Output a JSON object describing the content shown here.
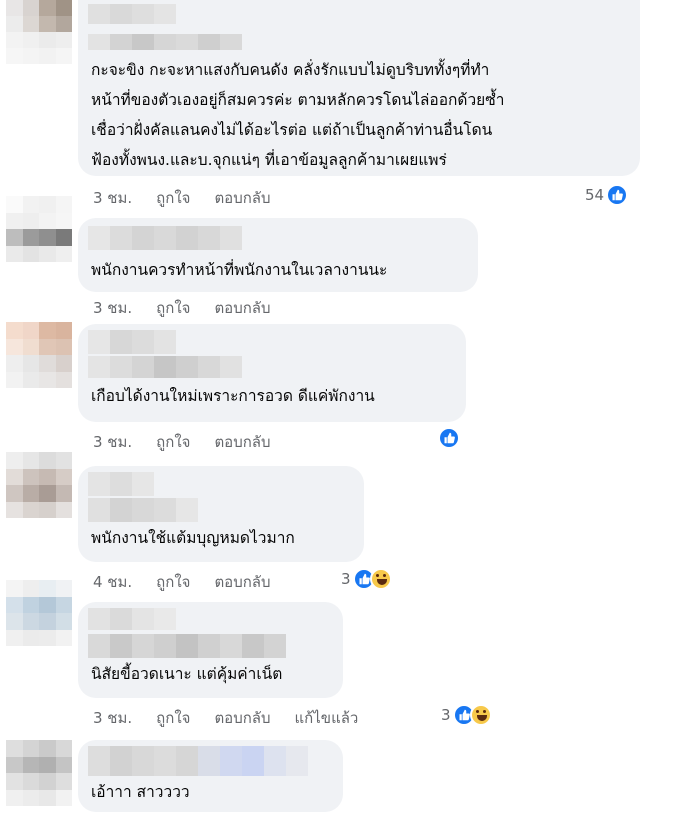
{
  "comments": [
    {
      "lines": [
        "กะจะขิง กะจะหาแสงกับคนดัง คลั่งรักแบบไม่ดูบริบททั้งๆที่ทำ",
        "หน้าที่ของตัวเองอยู่ก็สมควรค่ะ ตามหลักควรโดนไล่ออกด้วยซ้ำ",
        "เชื่อว่าฝั่งคัลแลนคงไม่ได้อะไรต่อ แต่ถ้าเป็นลูกค้าท่านอื่นโดน",
        "ฟ้องทั้งพนง.และบ.จุกแน่ๆ ที่เอาข้อมูลลูกค้ามาเผยแพร่"
      ],
      "time": "3 ชม.",
      "like_label": "ถูกใจ",
      "reply_label": "ตอบกลับ",
      "reaction_count": "54",
      "reactions": [
        "like-icon"
      ]
    },
    {
      "lines": [
        "พนักงานควรทำหน้าที่พนักงานในเวลางานนะ"
      ],
      "time": "3 ชม.",
      "like_label": "ถูกใจ",
      "reply_label": "ตอบกลับ",
      "reaction_count": "",
      "reactions": []
    },
    {
      "lines": [
        "เกือบได้งานใหม่เพราะการอวด ดีแค่พักงาน"
      ],
      "time": "3 ชม.",
      "like_label": "ถูกใจ",
      "reply_label": "ตอบกลับ",
      "reaction_count": "",
      "reactions": [
        "like-icon"
      ]
    },
    {
      "lines": [
        "พนักงานใช้แต้มบุญหมดไวมาก"
      ],
      "time": "4 ชม.",
      "like_label": "ถูกใจ",
      "reply_label": "ตอบกลับ",
      "reaction_count": "3",
      "reactions": [
        "like-icon",
        "haha-icon"
      ]
    },
    {
      "lines": [
        "นิสัยขี้อวดเนาะ แต่คุ้มค่าเน็ต"
      ],
      "time": "3 ชม.",
      "like_label": "ถูกใจ",
      "reply_label": "ตอบกลับ",
      "edited_label": "แก้ไขแล้ว",
      "reaction_count": "3",
      "reactions": [
        "like-icon",
        "haha-icon"
      ]
    },
    {
      "lines": [
        "เอ้าาา สาวววว"
      ],
      "time": "",
      "like_label": "",
      "reply_label": "",
      "reaction_count": "",
      "reactions": []
    }
  ]
}
